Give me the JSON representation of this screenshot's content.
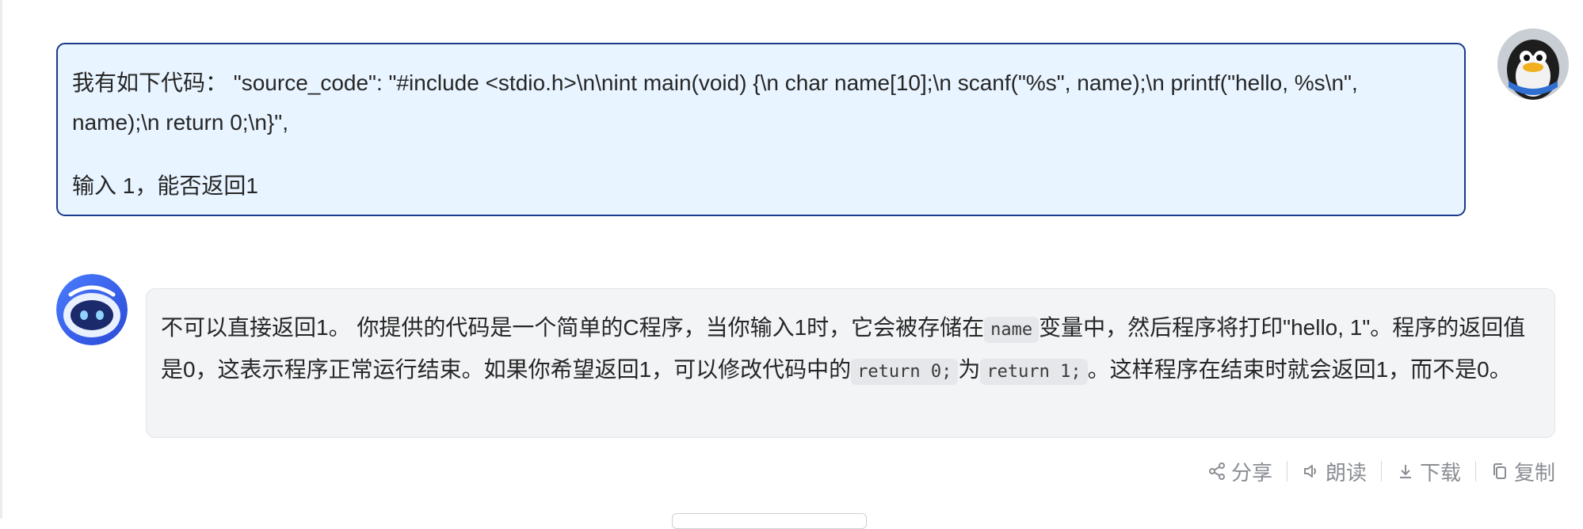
{
  "user_message": {
    "line1": "我有如下代码：  \"source_code\": \"#include <stdio.h>\\n\\nint main(void) {\\n char name[10];\\n scanf(\"%s\", name);\\n printf(\"hello, %s\\n\", name);\\n return 0;\\n}\",",
    "line2": "输入 1，能否返回1"
  },
  "assistant_message": {
    "part1": "不可以直接返回1。 你提供的代码是一个简单的C程序，当你输入1时，它会被存储在",
    "code1": "name",
    "part2": "变量中，然后程序将打印\"hello, 1\"。程序的返回值是0，这表示程序正常运行结束。如果你希望返回1，可以修改代码中的",
    "code2": "return 0;",
    "part3": "为",
    "code3": "return 1;",
    "part4": "。这样程序在结束时就会返回1，而不是0。"
  },
  "actions": {
    "share": "分享",
    "read": "朗读",
    "download": "下载",
    "copy": "复制"
  },
  "icons": {
    "share": "share-icon",
    "read": "speaker-icon",
    "download": "download-icon",
    "copy": "copy-icon"
  },
  "colors": {
    "user_bubble_bg": "#e8f4ff",
    "user_bubble_border": "#1b3a8a",
    "bot_bubble_bg": "#f3f4f6",
    "action_text": "#8a8d93"
  }
}
